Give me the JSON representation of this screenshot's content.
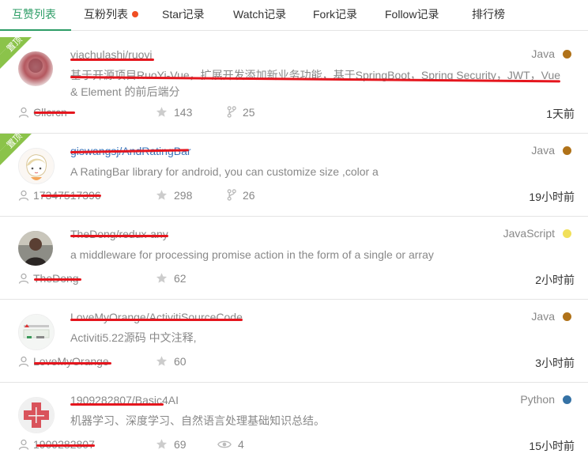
{
  "tabs": [
    {
      "label": "互赞列表",
      "active": true
    },
    {
      "label": "互粉列表",
      "badge_color": "#f04e23"
    },
    {
      "label": "Star记录"
    },
    {
      "label": "Watch记录"
    },
    {
      "label": "Fork记录"
    },
    {
      "label": "Follow记录"
    },
    {
      "label": "排行榜"
    }
  ],
  "pin_label": "置顶",
  "colors": {
    "accent": "#2d9d66",
    "pin": "#8bc34a",
    "redaction": "#e5161e"
  },
  "repos": [
    {
      "pinned": true,
      "name": "yiachulashi/ruoyi",
      "description": "基于开源项目RuoYi-Vue，扩展开发添加新业务功能，基于SpringBoot，Spring Security，JWT，Vue & Element 的前后端分",
      "language": "Java",
      "language_color": "#b07219",
      "user": "Cllcrcn",
      "stars": "143",
      "stat2_icon": "fork-icon",
      "stat2": "25",
      "time": "1天前"
    },
    {
      "pinned": true,
      "name": "giswangsj/AndRatingBar",
      "description": "A RatingBar library for android, you can customize size ,color a",
      "language": "Java",
      "language_color": "#b07219",
      "user": "17347517396",
      "stars": "298",
      "stat2_icon": "fork-icon",
      "stat2": "26",
      "time": "19小时前"
    },
    {
      "pinned": false,
      "name": "TheDong/redux-any",
      "description": "a middleware for processing promise action in the form of a single or array",
      "language": "JavaScript",
      "language_color": "#f1e05a",
      "user": "TheDong",
      "stars": "62",
      "time": "2小时前"
    },
    {
      "pinned": false,
      "name": "LoveMyOrange/ActivitiSourceCode",
      "description": "Activiti5.22源码 中文注释,",
      "language": "Java",
      "language_color": "#b07219",
      "user": "LoveMyOrange",
      "stars": "60",
      "time": "3小时前"
    },
    {
      "pinned": false,
      "name": "1909282807/Basic4AI",
      "description": "机器学习、深度学习、自然语言处理基础知识总结。",
      "language": "Python",
      "language_color": "#3572a5",
      "user": "1909282807",
      "stars": "69",
      "stat2_icon": "eye-icon",
      "stat2": "4",
      "time": "15小时前"
    }
  ]
}
